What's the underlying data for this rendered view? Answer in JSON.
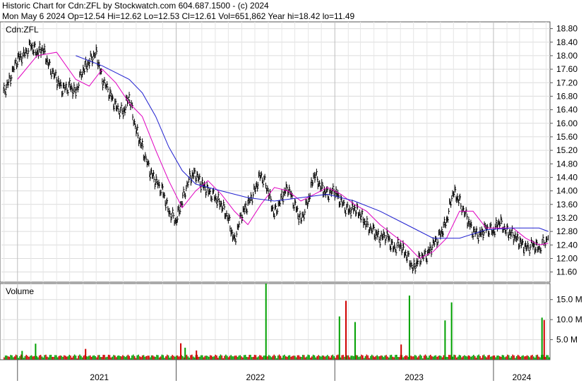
{
  "header": {
    "line1": "Historic Chart for Cdn:ZFL by Stockwatch.com 604.687.1500 - (c) 2024",
    "line2": "Mon May  6 2024   Op=12.54   Hi=12.62   Lo=12.53   Cl=12.61   Vol=651,862   Year hi=18.42   lo=11.49"
  },
  "chart_data": [
    {
      "type": "candlestick",
      "title": "Cdn:ZFL",
      "xlabel": "",
      "ylabel": "",
      "ylim": [
        11.3,
        19.0
      ],
      "y_ticks": [
        "18.80",
        "18.40",
        "18.00",
        "17.60",
        "17.20",
        "16.80",
        "16.40",
        "16.00",
        "15.60",
        "15.20",
        "14.80",
        "14.40",
        "14.00",
        "13.60",
        "13.20",
        "12.80",
        "12.40",
        "12.00",
        "11.60"
      ],
      "x_tick_labels": [
        "2021",
        "2022",
        "2023",
        "2024"
      ],
      "grid": true,
      "series": [
        {
          "name": "",
          "kind": "price",
          "color": "#000000",
          "points": [
            {
              "date": "2020-11-30",
              "close": 16.9
            },
            {
              "date": "2020-12-15",
              "close": 17.3
            },
            {
              "date": "2021-01-01",
              "close": 17.9
            },
            {
              "date": "2021-01-15",
              "close": 18.0
            },
            {
              "date": "2021-02-01",
              "close": 18.3
            },
            {
              "date": "2021-02-15",
              "close": 18.1
            },
            {
              "date": "2021-03-01",
              "close": 18.2
            },
            {
              "date": "2021-03-15",
              "close": 17.7
            },
            {
              "date": "2021-04-01",
              "close": 17.3
            },
            {
              "date": "2021-04-15",
              "close": 17.0
            },
            {
              "date": "2021-05-01",
              "close": 17.1
            },
            {
              "date": "2021-05-15",
              "close": 16.9
            },
            {
              "date": "2021-06-01",
              "close": 17.6
            },
            {
              "date": "2021-06-15",
              "close": 17.8
            },
            {
              "date": "2021-07-01",
              "close": 18.1
            },
            {
              "date": "2021-07-15",
              "close": 17.3
            },
            {
              "date": "2021-08-01",
              "close": 16.9
            },
            {
              "date": "2021-08-15",
              "close": 16.5
            },
            {
              "date": "2021-09-01",
              "close": 16.3
            },
            {
              "date": "2021-09-15",
              "close": 16.8
            },
            {
              "date": "2021-10-01",
              "close": 15.8
            },
            {
              "date": "2021-10-15",
              "close": 15.3
            },
            {
              "date": "2021-11-01",
              "close": 14.6
            },
            {
              "date": "2021-11-15",
              "close": 14.3
            },
            {
              "date": "2021-12-01",
              "close": 14.0
            },
            {
              "date": "2021-12-15",
              "close": 13.4
            },
            {
              "date": "2022-01-01",
              "close": 13.1
            },
            {
              "date": "2022-01-15",
              "close": 13.7
            },
            {
              "date": "2022-02-01",
              "close": 14.4
            },
            {
              "date": "2022-02-15",
              "close": 14.5
            },
            {
              "date": "2022-03-01",
              "close": 14.2
            },
            {
              "date": "2022-03-15",
              "close": 14.0
            },
            {
              "date": "2022-04-01",
              "close": 13.8
            },
            {
              "date": "2022-04-15",
              "close": 13.6
            },
            {
              "date": "2022-05-01",
              "close": 13.2
            },
            {
              "date": "2022-05-15",
              "close": 12.5
            },
            {
              "date": "2022-06-01",
              "close": 13.3
            },
            {
              "date": "2022-06-15",
              "close": 13.6
            },
            {
              "date": "2022-07-01",
              "close": 14.0
            },
            {
              "date": "2022-07-15",
              "close": 14.5
            },
            {
              "date": "2022-08-01",
              "close": 14.0
            },
            {
              "date": "2022-08-15",
              "close": 13.3
            },
            {
              "date": "2022-09-01",
              "close": 13.8
            },
            {
              "date": "2022-09-15",
              "close": 14.1
            },
            {
              "date": "2022-10-01",
              "close": 13.6
            },
            {
              "date": "2022-10-15",
              "close": 13.1
            },
            {
              "date": "2022-11-01",
              "close": 13.7
            },
            {
              "date": "2022-11-15",
              "close": 14.5
            },
            {
              "date": "2022-12-01",
              "close": 14.1
            },
            {
              "date": "2022-12-15",
              "close": 13.9
            },
            {
              "date": "2023-01-01",
              "close": 14.0
            },
            {
              "date": "2023-01-15",
              "close": 13.7
            },
            {
              "date": "2023-02-01",
              "close": 13.4
            },
            {
              "date": "2023-02-15",
              "close": 13.5
            },
            {
              "date": "2023-03-01",
              "close": 13.3
            },
            {
              "date": "2023-03-15",
              "close": 13.0
            },
            {
              "date": "2023-04-01",
              "close": 12.8
            },
            {
              "date": "2023-04-15",
              "close": 12.6
            },
            {
              "date": "2023-05-01",
              "close": 12.7
            },
            {
              "date": "2023-05-15",
              "close": 12.3
            },
            {
              "date": "2023-06-01",
              "close": 12.4
            },
            {
              "date": "2023-06-15",
              "close": 12.1
            },
            {
              "date": "2023-07-01",
              "close": 11.7
            },
            {
              "date": "2023-07-15",
              "close": 12.0
            },
            {
              "date": "2023-08-01",
              "close": 12.1
            },
            {
              "date": "2023-08-15",
              "close": 12.4
            },
            {
              "date": "2023-09-01",
              "close": 12.7
            },
            {
              "date": "2023-09-15",
              "close": 13.1
            },
            {
              "date": "2023-10-01",
              "close": 14.0
            },
            {
              "date": "2023-10-15",
              "close": 13.7
            },
            {
              "date": "2023-11-01",
              "close": 13.2
            },
            {
              "date": "2023-11-15",
              "close": 12.8
            },
            {
              "date": "2023-12-01",
              "close": 12.7
            },
            {
              "date": "2023-12-15",
              "close": 12.9
            },
            {
              "date": "2024-01-01",
              "close": 12.8
            },
            {
              "date": "2024-01-15",
              "close": 13.1
            },
            {
              "date": "2024-02-01",
              "close": 12.8
            },
            {
              "date": "2024-02-15",
              "close": 12.7
            },
            {
              "date": "2024-03-01",
              "close": 12.5
            },
            {
              "date": "2024-03-15",
              "close": 12.3
            },
            {
              "date": "2024-04-01",
              "close": 12.4
            },
            {
              "date": "2024-04-15",
              "close": 12.3
            },
            {
              "date": "2024-05-06",
              "close": 12.61
            }
          ]
        },
        {
          "name": "",
          "kind": "moving-average-short",
          "color": "#e000c0",
          "points": [
            {
              "date": "2021-01-01",
              "value": 17.3
            },
            {
              "date": "2021-02-15",
              "value": 18.0
            },
            {
              "date": "2021-04-01",
              "value": 18.1
            },
            {
              "date": "2021-05-15",
              "value": 17.3
            },
            {
              "date": "2021-06-15",
              "value": 17.1
            },
            {
              "date": "2021-07-15",
              "value": 17.6
            },
            {
              "date": "2021-08-15",
              "value": 17.2
            },
            {
              "date": "2021-09-15",
              "value": 16.6
            },
            {
              "date": "2021-10-15",
              "value": 16.2
            },
            {
              "date": "2021-11-15",
              "value": 15.2
            },
            {
              "date": "2021-12-15",
              "value": 14.3
            },
            {
              "date": "2022-01-15",
              "value": 13.5
            },
            {
              "date": "2022-02-15",
              "value": 14.0
            },
            {
              "date": "2022-03-15",
              "value": 14.3
            },
            {
              "date": "2022-04-15",
              "value": 13.9
            },
            {
              "date": "2022-05-15",
              "value": 13.4
            },
            {
              "date": "2022-06-15",
              "value": 13.0
            },
            {
              "date": "2022-07-15",
              "value": 13.6
            },
            {
              "date": "2022-08-15",
              "value": 14.1
            },
            {
              "date": "2022-09-15",
              "value": 14.0
            },
            {
              "date": "2022-10-15",
              "value": 13.7
            },
            {
              "date": "2022-11-15",
              "value": 13.9
            },
            {
              "date": "2022-12-15",
              "value": 14.1
            },
            {
              "date": "2023-01-15",
              "value": 13.9
            },
            {
              "date": "2023-02-15",
              "value": 13.6
            },
            {
              "date": "2023-03-15",
              "value": 13.4
            },
            {
              "date": "2023-04-15",
              "value": 13.0
            },
            {
              "date": "2023-05-15",
              "value": 12.7
            },
            {
              "date": "2023-06-15",
              "value": 12.4
            },
            {
              "date": "2023-07-15",
              "value": 12.0
            },
            {
              "date": "2023-08-15",
              "value": 12.2
            },
            {
              "date": "2023-09-15",
              "value": 12.6
            },
            {
              "date": "2023-10-15",
              "value": 13.4
            },
            {
              "date": "2023-11-15",
              "value": 13.4
            },
            {
              "date": "2023-12-15",
              "value": 12.9
            },
            {
              "date": "2024-01-15",
              "value": 12.9
            },
            {
              "date": "2024-02-15",
              "value": 12.9
            },
            {
              "date": "2024-03-15",
              "value": 12.6
            },
            {
              "date": "2024-04-15",
              "value": 12.4
            },
            {
              "date": "2024-05-06",
              "value": 12.45
            }
          ]
        },
        {
          "name": "",
          "kind": "moving-average-long",
          "color": "#2020d0",
          "points": [
            {
              "date": "2021-05-15",
              "value": 18.0
            },
            {
              "date": "2021-07-15",
              "value": 17.7
            },
            {
              "date": "2021-09-15",
              "value": 17.3
            },
            {
              "date": "2021-10-15",
              "value": 16.9
            },
            {
              "date": "2021-11-15",
              "value": 16.2
            },
            {
              "date": "2021-12-15",
              "value": 15.3
            },
            {
              "date": "2022-01-15",
              "value": 14.6
            },
            {
              "date": "2022-02-15",
              "value": 14.2
            },
            {
              "date": "2022-04-15",
              "value": 14.0
            },
            {
              "date": "2022-06-15",
              "value": 13.8
            },
            {
              "date": "2022-08-15",
              "value": 13.7
            },
            {
              "date": "2022-10-15",
              "value": 13.8
            },
            {
              "date": "2022-12-15",
              "value": 13.9
            },
            {
              "date": "2023-02-15",
              "value": 13.7
            },
            {
              "date": "2023-04-15",
              "value": 13.4
            },
            {
              "date": "2023-06-15",
              "value": 13.0
            },
            {
              "date": "2023-08-15",
              "value": 12.6
            },
            {
              "date": "2023-10-15",
              "value": 12.6
            },
            {
              "date": "2023-12-15",
              "value": 12.85
            },
            {
              "date": "2024-02-15",
              "value": 12.9
            },
            {
              "date": "2024-04-15",
              "value": 12.9
            },
            {
              "date": "2024-05-06",
              "value": 12.8
            }
          ]
        }
      ]
    },
    {
      "type": "bar",
      "title": "Volume",
      "xlabel": "",
      "ylabel": "",
      "ylim": [
        0,
        19000000
      ],
      "y_ticks": [
        "15.0 M",
        "10.0 M",
        "5.0 M"
      ],
      "grid": true,
      "colors": {
        "up": "#00a000",
        "down": "#d00000"
      },
      "bars": [
        {
          "date": "2021-01-10",
          "value": 2200000,
          "dir": "up"
        },
        {
          "date": "2021-02-10",
          "value": 4000000,
          "dir": "up"
        },
        {
          "date": "2021-06-05",
          "value": 2700000,
          "dir": "down"
        },
        {
          "date": "2022-01-10",
          "value": 4100000,
          "dir": "down"
        },
        {
          "date": "2022-01-20",
          "value": 3000000,
          "dir": "up"
        },
        {
          "date": "2022-02-15",
          "value": 2300000,
          "dir": "down"
        },
        {
          "date": "2022-07-25",
          "value": 19000000,
          "dir": "up"
        },
        {
          "date": "2023-01-10",
          "value": 10800000,
          "dir": "up"
        },
        {
          "date": "2023-01-25",
          "value": 14700000,
          "dir": "down"
        },
        {
          "date": "2023-02-15",
          "value": 9400000,
          "dir": "up"
        },
        {
          "date": "2023-06-01",
          "value": 3800000,
          "dir": "down"
        },
        {
          "date": "2023-06-20",
          "value": 16000000,
          "dir": "up"
        },
        {
          "date": "2023-09-10",
          "value": 9800000,
          "dir": "up"
        },
        {
          "date": "2023-09-25",
          "value": 14300000,
          "dir": "up"
        },
        {
          "date": "2024-04-20",
          "value": 10500000,
          "dir": "up"
        },
        {
          "date": "2024-04-25",
          "value": 9900000,
          "dir": "down"
        }
      ]
    }
  ]
}
